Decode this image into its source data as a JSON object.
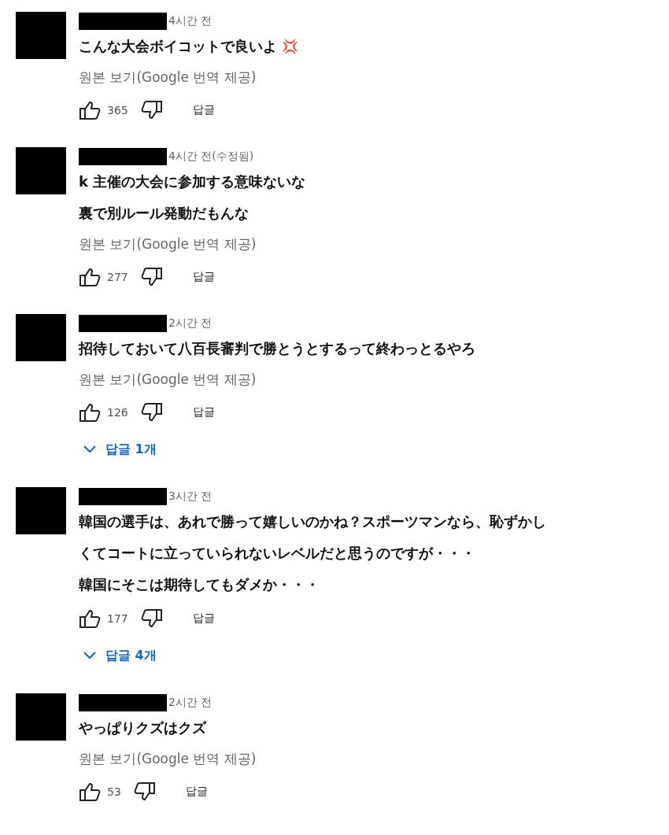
{
  "comments": [
    {
      "time": "4시간 전",
      "lines": [
        "こんな大会ボイコットで良いよ"
      ],
      "emoji": "💢",
      "translation": "원본 보기(Google 번역 제공)",
      "likes": "365",
      "reply": "답글"
    },
    {
      "time": "4시간 전(수정됨)",
      "lines": [
        "k 主催の大会に参加する意味ないな",
        "裏で別ルール発動だもんな"
      ],
      "translation": "원본 보기(Google 번역 제공)",
      "likes": "277",
      "reply": "답글"
    },
    {
      "time": "2시간 전",
      "lines": [
        "招待しておいて八百長審判で勝とうとするって終わっとるやろ"
      ],
      "translation": "원본 보기(Google 번역 제공)",
      "likes": "126",
      "reply": "답글",
      "replies": "답글 1개"
    },
    {
      "time": "3시간 전",
      "lines": [
        "韓国の選手は、あれで勝って嬉しいのかね？スポーツマンなら、恥ずかし",
        "くてコートに立っていられないレベルだと思うのですが・・・",
        "韓国にそこは期待してもダメか・・・"
      ],
      "likes": "177",
      "reply": "답글",
      "replies": "답글 4개"
    },
    {
      "time": "2시간 전",
      "lines": [
        "やっぱりクズはクズ"
      ],
      "translation": "원본 보기(Google 번역 제공)",
      "likes": "53",
      "reply": "답글"
    }
  ]
}
